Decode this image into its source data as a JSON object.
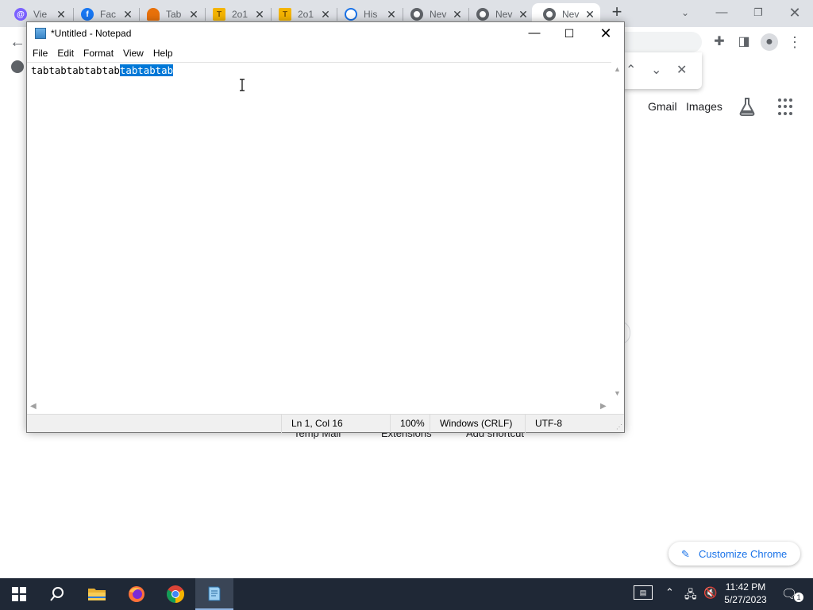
{
  "chrome": {
    "tabs": [
      {
        "title": "Vie",
        "favicon": "at-sign-icon",
        "color": "#7b61ff"
      },
      {
        "title": "Fac",
        "favicon": "facebook-icon",
        "color": "#1877f2"
      },
      {
        "title": "Tab",
        "favicon": "cloud-icon",
        "color": "#e8710a"
      },
      {
        "title": "2o1",
        "favicon": "t-logo-icon",
        "color": "#f4b400"
      },
      {
        "title": "2o1",
        "favicon": "t-logo-icon",
        "color": "#f4b400"
      },
      {
        "title": "His",
        "favicon": "history-icon",
        "color": "#1a73e8"
      },
      {
        "title": "Nev",
        "favicon": "chrome-icon",
        "color": "#5f6368"
      },
      {
        "title": "Nev",
        "favicon": "chrome-icon",
        "color": "#5f6368"
      },
      {
        "title": "Nev",
        "favicon": "chrome-icon",
        "color": "#5f6368"
      }
    ],
    "newtab_label": "+",
    "header_links": {
      "gmail": "Gmail",
      "images": "Images"
    },
    "shortcuts": [
      "Temp Mail",
      "Extensions",
      "Add shortcut"
    ],
    "customize_label": "Customize Chrome"
  },
  "notepad": {
    "title": "*Untitled - Notepad",
    "menu": [
      "File",
      "Edit",
      "Format",
      "View",
      "Help"
    ],
    "text_before_selection": "tabtabtabtabtab",
    "text_selected": "tabtabtab",
    "status": {
      "position": "Ln 1, Col 16",
      "zoom": "100%",
      "line_ending": "Windows (CRLF)",
      "encoding": "UTF-8"
    }
  },
  "taskbar": {
    "apps": [
      {
        "name": "start-button"
      },
      {
        "name": "search-button"
      },
      {
        "name": "file-explorer"
      },
      {
        "name": "firefox"
      },
      {
        "name": "chrome"
      },
      {
        "name": "notepad",
        "active": true
      }
    ],
    "time": "11:42 PM",
    "date": "5/27/2023",
    "notification_count": "1"
  },
  "colors": {
    "selection": "#0078d7",
    "taskbar": "#1f2836",
    "tabstrip": "#dee1e6",
    "accent": "#1a73e8"
  }
}
